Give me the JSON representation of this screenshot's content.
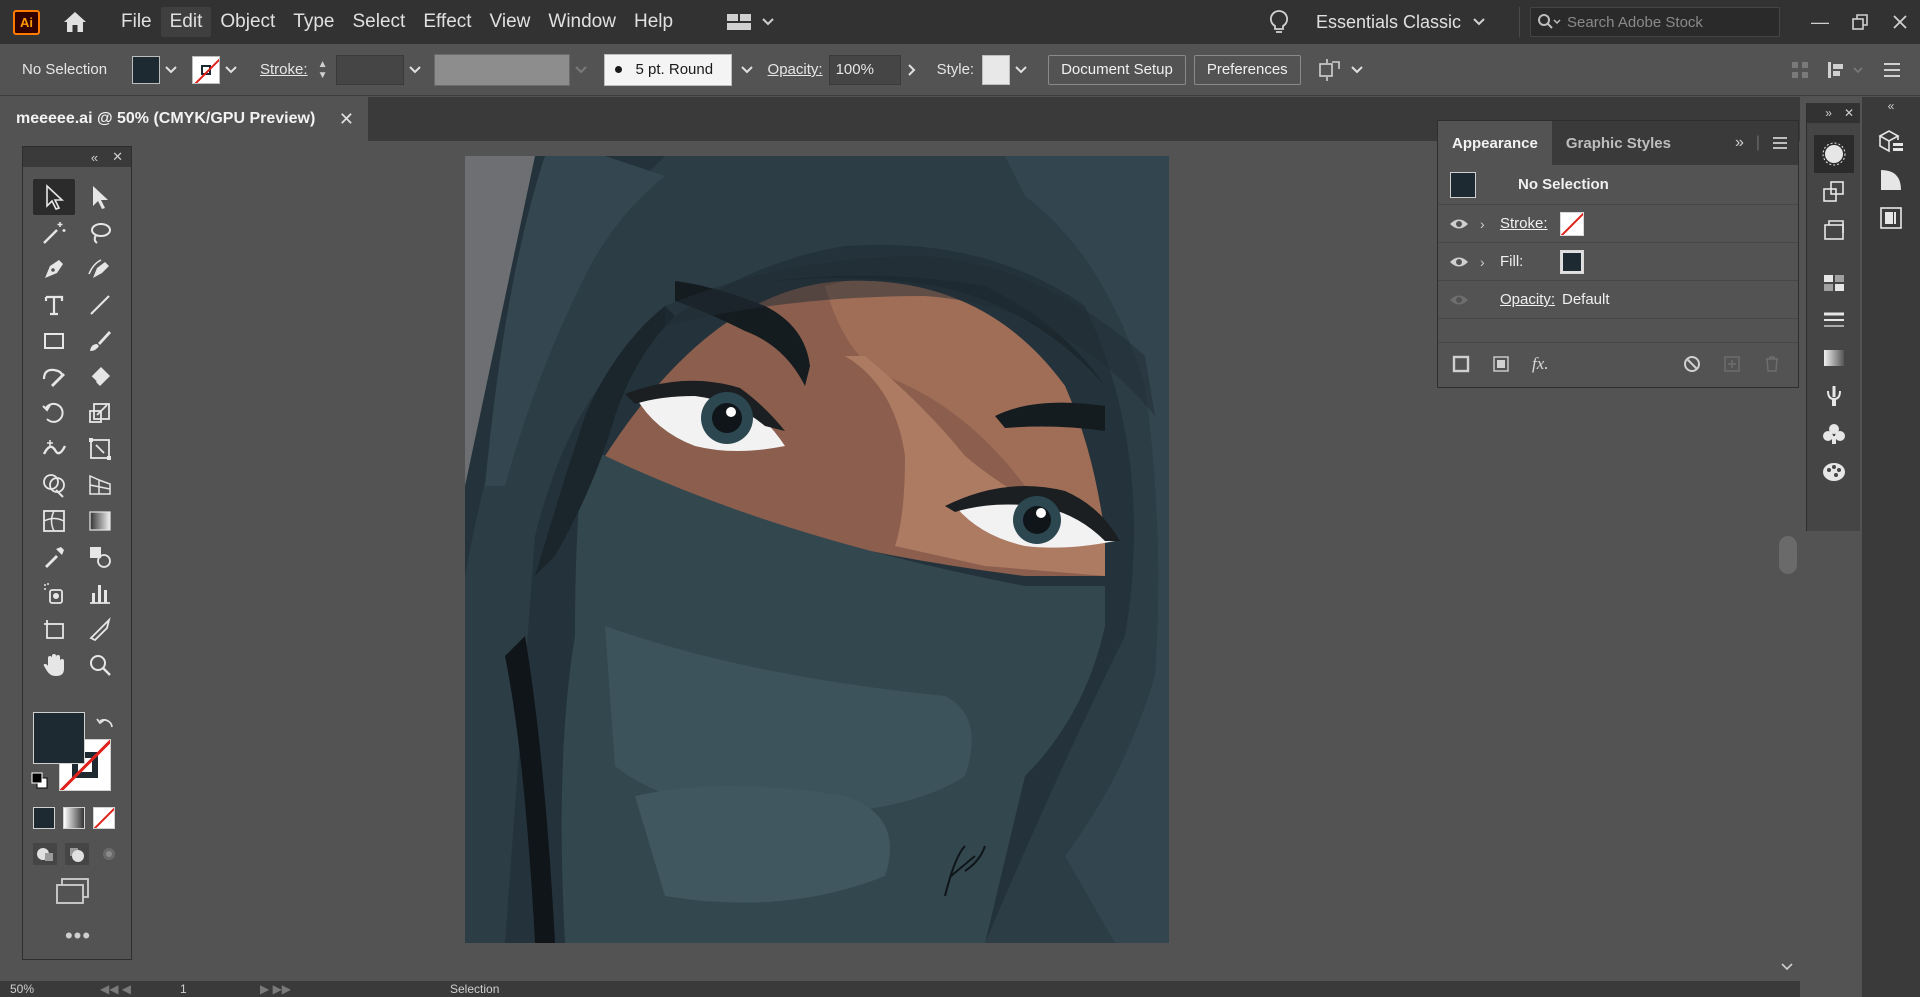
{
  "app": {
    "logo_text": "Ai",
    "menu": [
      "File",
      "Edit",
      "Object",
      "Type",
      "Select",
      "Effect",
      "View",
      "Window",
      "Help"
    ],
    "workspace": "Essentials Classic",
    "stock_search_placeholder": "Search Adobe Stock"
  },
  "control_bar": {
    "selection_label": "No Selection",
    "stroke_label": "Stroke:",
    "brush_label": "5 pt. Round",
    "opacity_label": "Opacity:",
    "opacity_value": "100%",
    "style_label": "Style:",
    "document_setup": "Document Setup",
    "preferences": "Preferences"
  },
  "document": {
    "tab_title": "meeeee.ai @ 50% (CMYK/GPU Preview)"
  },
  "appearance_panel": {
    "tabs": [
      "Appearance",
      "Graphic Styles"
    ],
    "active_tab": "Appearance",
    "title": "No Selection",
    "rows": [
      {
        "label": "Stroke:",
        "value": ""
      },
      {
        "label": "Fill:",
        "value": ""
      },
      {
        "label": "Opacity:",
        "value": "Default"
      }
    ]
  },
  "status_bar": {
    "zoom": "50%",
    "artboard": "1",
    "tool_name": "Selection"
  },
  "colors": {
    "fill": "#1e2a32",
    "skin": "#8a5a48",
    "hijab": "#2c3c44",
    "accent_orange": "#ff7c00",
    "stroke_none_red": "#e0201b"
  }
}
